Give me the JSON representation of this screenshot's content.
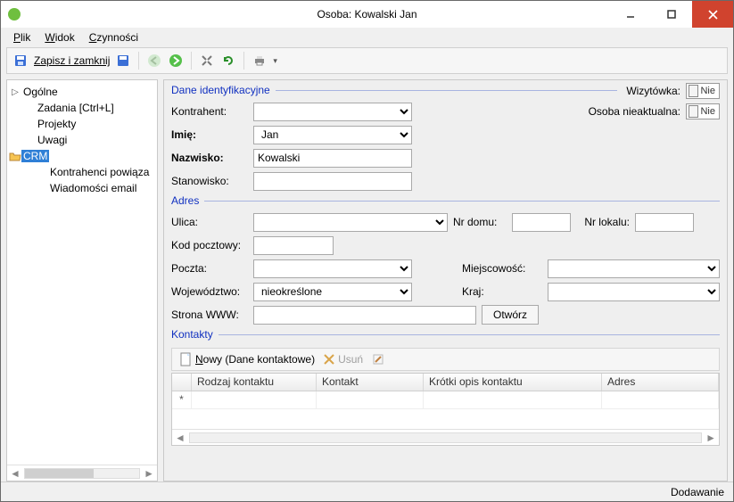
{
  "window": {
    "title": "Osoba: Kowalski Jan"
  },
  "menu": {
    "plik": "Plik",
    "widok": "Widok",
    "czynnosci": "Czynności"
  },
  "toolbar": {
    "save_close": "Zapisz i zamknij"
  },
  "sidebar": {
    "items": [
      {
        "label": "Ogólne"
      },
      {
        "label": "Zadania [Ctrl+L]"
      },
      {
        "label": "Projekty"
      },
      {
        "label": "Uwagi"
      },
      {
        "label": "CRM"
      },
      {
        "label": "Kontrahenci powiąza"
      },
      {
        "label": "Wiadomości email"
      }
    ]
  },
  "sections": {
    "ident": "Dane identyfikacyjne",
    "adres": "Adres",
    "kontakty": "Kontakty"
  },
  "labels": {
    "wizytowka": "Wizytówka:",
    "nieaktualna": "Osoba nieaktualna:",
    "kontrahent": "Kontrahent:",
    "imie": "Imię:",
    "nazwisko": "Nazwisko:",
    "stanowisko": "Stanowisko:",
    "ulica": "Ulica:",
    "nrdomu": "Nr domu:",
    "nrlokalu": "Nr lokalu:",
    "kod": "Kod pocztowy:",
    "poczta": "Poczta:",
    "miejscowosc": "Miejscowość:",
    "woj": "Województwo:",
    "kraj": "Kraj:",
    "www": "Strona WWW:",
    "otworz": "Otwórz",
    "toggle_no": "Nie"
  },
  "fields": {
    "kontrahent": "",
    "imie": "Jan",
    "nazwisko": "Kowalski",
    "stanowisko": "",
    "ulica": "",
    "nrdomu": "",
    "nrlokalu": "",
    "kod": "",
    "poczta": "",
    "miejscowosc": "",
    "woj": "nieokreślone",
    "kraj": "",
    "www": ""
  },
  "contacts_toolbar": {
    "nowy": "Nowy (Dane kontaktowe)",
    "usun": "Usuń"
  },
  "grid": {
    "headers": [
      "Rodzaj kontaktu",
      "Kontakt",
      "Krótki opis kontaktu",
      "Adres"
    ],
    "newrow_marker": "*"
  },
  "status": {
    "mode": "Dodawanie"
  }
}
